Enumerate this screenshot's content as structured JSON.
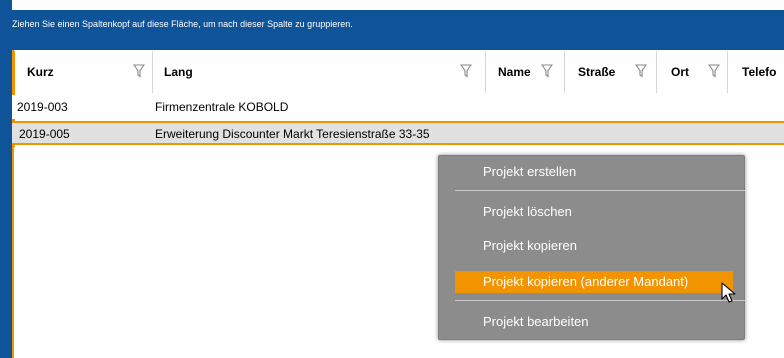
{
  "group_panel": {
    "hint": "Ziehen Sie einen Spaltenkopf auf diese Fläche, um nach dieser Spalte zu gruppieren."
  },
  "columns": [
    {
      "label": "Kurz",
      "filter_icon": "filter-icon"
    },
    {
      "label": "Lang",
      "filter_icon": "filter-icon"
    },
    {
      "label": "Name",
      "filter_icon": "filter-icon"
    },
    {
      "label": "Straße",
      "filter_icon": "filter-icon"
    },
    {
      "label": "Ort",
      "filter_icon": "filter-icon"
    },
    {
      "label": "Telefo"
    }
  ],
  "rows": [
    {
      "kurz": "2019-003",
      "lang": "Firmenzentrale KOBOLD"
    },
    {
      "kurz": "2019-005",
      "lang": "Erweiterung Discounter Markt Teresienstraße 33-35",
      "selected": true
    }
  ],
  "context_menu": {
    "items": [
      {
        "label": "Projekt erstellen"
      },
      {
        "label": "Projekt löschen"
      },
      {
        "label": "Projekt kopieren"
      },
      {
        "label": "Projekt kopieren (anderer Mandant)",
        "highlighted": true
      },
      {
        "label": "Projekt bearbeiten"
      }
    ]
  },
  "colors": {
    "brand_blue": "#0f5398",
    "accent_orange": "#f29400",
    "menu_gray": "#8c8c8c",
    "selected_row": "#e1e1e1"
  },
  "cursor": "arrow-pointer-icon"
}
